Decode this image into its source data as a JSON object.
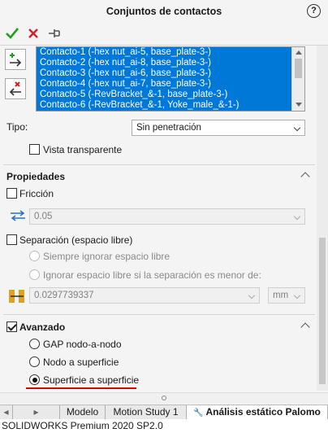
{
  "header": {
    "title": "Conjuntos de contactos",
    "help_icon": "?"
  },
  "actions": {
    "ok_icon": "check-icon",
    "cancel_icon": "close-icon",
    "pin_icon": "pin-icon"
  },
  "contacts_list": {
    "items": [
      "Contacto-1 (-hex nut_ai-5, base_plate-3-)",
      "Contacto-2 (-hex nut_ai-8, base_plate-3-)",
      "Contacto-3 (-hex nut_ai-6, base_plate-3-)",
      "Contacto-4 (-hex nut_ai-7, base_plate-3-)",
      "Contacto-5 (-RevBracket_&-1, base_plate-3-)",
      "Contacto-6 (-RevBracket_&-1, Yoke_male_&-1-)"
    ]
  },
  "type_row": {
    "label": "Tipo:",
    "value": "Sin penetración"
  },
  "transparent": {
    "label": "Vista transparente",
    "checked": false
  },
  "properties": {
    "title": "Propiedades",
    "friction": {
      "label": "Fricción",
      "checked": false,
      "value": "0.05"
    },
    "separation": {
      "label": "Separación (espacio libre)",
      "checked": false,
      "opt_always": "Siempre ignorar espacio libre",
      "opt_ignore_if": "Ignorar espacio libre si la separación es menor de:",
      "value": "0.0297739337",
      "unit": "mm"
    }
  },
  "advanced": {
    "title": "Avanzado",
    "checked": true,
    "options": [
      "GAP nodo-a-nodo",
      "Nodo a superficie",
      "Superficie a superficie"
    ],
    "selected_index": 2
  },
  "tabs": [
    "Modelo",
    "Motion Study 1",
    "Análisis estático Palomo"
  ],
  "status": "SOLIDWORKS Premium 2020 SP2.0",
  "colors": {
    "selection": "#0078d7",
    "ok": "#1e9e1e",
    "cancel": "#d32020",
    "underline": "#e00000"
  }
}
